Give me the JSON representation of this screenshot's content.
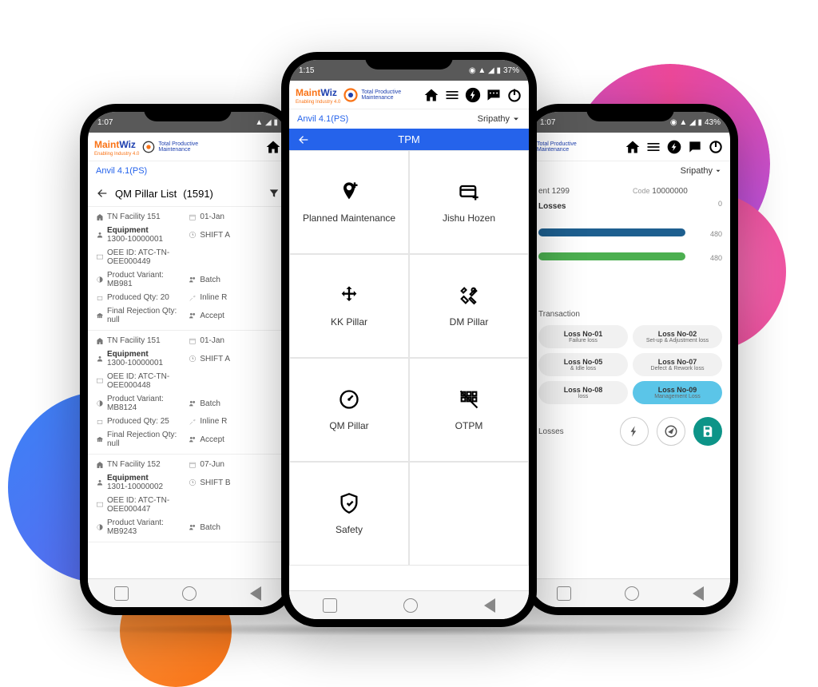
{
  "decor": {},
  "common": {
    "logo_main": "Maint",
    "logo_wiz": "Wiz",
    "logo_sub": "Enabling Industry 4.0",
    "tpm_line1": "Total Productive",
    "tpm_line2": "Maintenance",
    "anvil": "Anvil 4.1(PS)",
    "user": "Sripathy"
  },
  "left": {
    "status_time": "1:07",
    "list_title": "QM Pillar List",
    "list_count": "(1591)",
    "cards": [
      {
        "facility": "TN Facility 151",
        "date": "01-Jan",
        "equip_label": "Equipment",
        "equip_val": "1300-10000001",
        "shift": "SHIFT A",
        "oee": "OEE ID: ATC-TN-OEE000449",
        "variant_label": "Product Variant:",
        "variant_val": "MB981",
        "batch": "Batch",
        "prod": "Produced Qty: 20",
        "inline": "Inline R",
        "rej": "Final Rejection Qty:",
        "rej_val": "null",
        "accept": "Accept"
      },
      {
        "facility": "TN Facility 151",
        "date": "01-Jan",
        "equip_label": "Equipment",
        "equip_val": "1300-10000001",
        "shift": "SHIFT A",
        "oee": "OEE ID: ATC-TN-OEE000448",
        "variant_label": "Product Variant:",
        "variant_val": "MB8124",
        "batch": "Batch",
        "prod": "Produced Qty: 25",
        "inline": "Inline R",
        "rej": "Final Rejection Qty:",
        "rej_val": "null",
        "accept": "Accept"
      },
      {
        "facility": "TN Facility 152",
        "date": "07-Jun",
        "equip_label": "Equipment",
        "equip_val": "1301-10000002",
        "shift": "SHIFT B",
        "oee": "OEE ID: ATC-TN-OEE000447",
        "variant_label": "Product Variant:",
        "variant_val": "MB9243",
        "batch": "Batch",
        "prod": "",
        "inline": "",
        "rej": "",
        "rej_val": "",
        "accept": ""
      }
    ]
  },
  "center": {
    "status_time": "1:15",
    "battery": "37%",
    "title": "TPM",
    "tiles": [
      {
        "label": "Planned Maintenance",
        "icon": "pin-plus"
      },
      {
        "label": "Jishu Hozen",
        "icon": "card-plus"
      },
      {
        "label": "KK Pillar",
        "icon": "move"
      },
      {
        "label": "DM Pillar",
        "icon": "tools"
      },
      {
        "label": "QM Pillar",
        "icon": "gauge"
      },
      {
        "label": "OTPM",
        "icon": "grid-off"
      },
      {
        "label": "Safety",
        "icon": "shield"
      }
    ]
  },
  "right": {
    "status_time": "1:07",
    "battery": "43%",
    "ent_label": "ent 1299",
    "code_label": "Code",
    "code_val": "10000000",
    "losses_label": "Losses",
    "zero": "0",
    "v480a": "480",
    "v480b": "480",
    "transaction": "Transaction",
    "pills": [
      {
        "t": "Loss No-01",
        "s": "Failure loss",
        "partial": true
      },
      {
        "t": "Loss No-02",
        "s": "Set-up & Adjustment loss"
      },
      {
        "t": "Loss No-05",
        "s": "& Idle loss",
        "partial": true
      },
      {
        "t": "Loss No-07",
        "s": "Defect & Rework loss"
      },
      {
        "t": "Loss No-08",
        "s": "loss",
        "partial": true
      },
      {
        "t": "Loss No-09",
        "s": "Management Loss",
        "active": true
      }
    ],
    "footer_label": "Losses"
  }
}
